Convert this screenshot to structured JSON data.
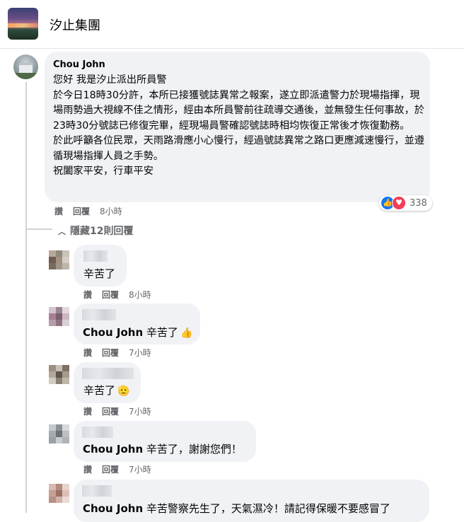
{
  "group": {
    "name": "汐止集團"
  },
  "main_comment": {
    "author": "Chou John",
    "text": "您好 我是汐止派出所員警\n於今日18時30分許，本所已接獲號誌異常之報案，遂立即派遣警力於現場指揮，現場雨勢過大視線不佳之情形，經由本所員警前往疏導交通後，並無發生任何事故，於23時30分號誌已修復完畢，經現場員警確認號誌時相均恢復正常後才恢復勤務。\n於此呼籲各位民眾，天雨路滑應小心慢行，經過號誌異常之路口更應減速慢行，並遵循現場指揮人員之手勢。\n祝闔家平安，行車平安",
    "like_label": "讚",
    "reply_label": "回覆",
    "time": "8小時",
    "reaction_count": "338",
    "reaction_icons": [
      "like-icon",
      "love-icon"
    ]
  },
  "hide_replies": {
    "label": "隱藏12則回覆"
  },
  "replies": [
    {
      "text": "辛苦了",
      "mention": "",
      "emoji": "",
      "like_label": "讚",
      "reply_label": "回覆",
      "time": "8小時"
    },
    {
      "mention": "Chou John",
      "text": "辛苦了",
      "emoji": "👍",
      "like_label": "讚",
      "reply_label": "回覆",
      "time": "7小時"
    },
    {
      "text": "辛苦了",
      "mention": "",
      "emoji": "🫡",
      "like_label": "讚",
      "reply_label": "回覆",
      "time": "7小時"
    },
    {
      "mention": "Chou John",
      "text": "辛苦了，謝謝您們！",
      "emoji": "",
      "like_label": "讚",
      "reply_label": "回覆",
      "time": "7小時"
    },
    {
      "mention": "Chou John",
      "text": "辛苦警察先生了，天氣濕冷！請記得保暖不要感冒了",
      "emoji": "",
      "like_label": "",
      "reply_label": "",
      "time": ""
    }
  ],
  "colors": {
    "bubble": "#f0f2f5",
    "meta": "#65676b",
    "like": "#1877f2",
    "love": "#f33e58"
  }
}
